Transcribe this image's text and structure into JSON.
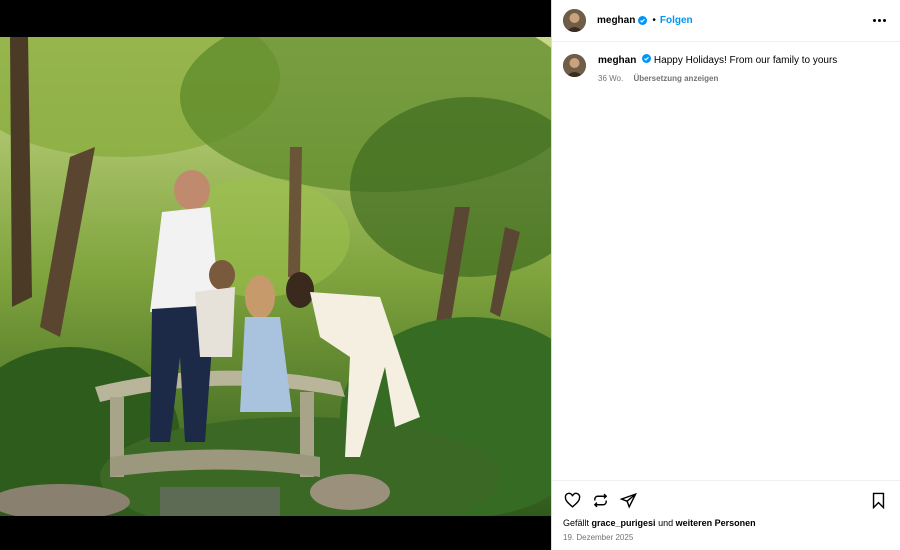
{
  "post": {
    "username": "meghan",
    "follow_label": "Folgen",
    "separator": "•",
    "caption": "Happy Holidays! From our family to yours",
    "age": "36 Wo.",
    "translate_label": "Übersetzung anzeigen"
  },
  "likes": {
    "prefix": "Gefällt",
    "user": "grace_purigesi",
    "connector": "und",
    "others": "weiteren Personen"
  },
  "date": "19. Dezember 2025",
  "colors": {
    "link_blue": "#0095f6",
    "verified_blue": "#0095f6",
    "meta_gray": "#737373"
  },
  "icons": {
    "like": "heart-icon",
    "comment": "comment-icon",
    "share": "share-icon",
    "save": "bookmark-icon",
    "more": "more-options-icon"
  }
}
